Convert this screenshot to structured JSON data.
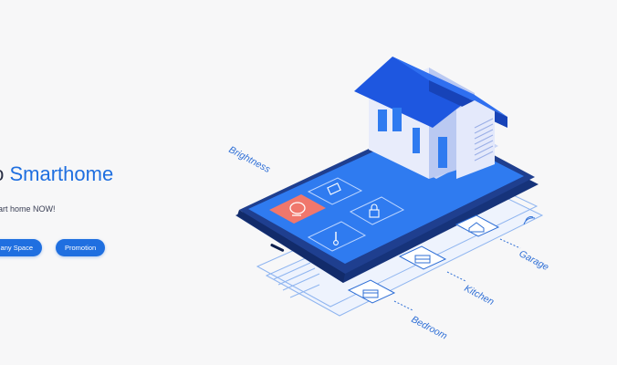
{
  "hero": {
    "heading_prefix": "to ",
    "heading_brand": "Smarthome",
    "subheading": "art home NOW!",
    "buttons": [
      {
        "label": "any Space"
      },
      {
        "label": "Promotion"
      }
    ]
  },
  "illustration": {
    "labels": {
      "brightness": "Brightness",
      "garage": "Garage",
      "kitchen": "Kitchen",
      "bedroom": "Bedroom"
    },
    "icons": [
      "battery-icon",
      "lightbulb-icon",
      "lock-icon",
      "thermometer-icon",
      "house-icon",
      "stove-icon",
      "bed-icon",
      "wifi-icon"
    ],
    "colors": {
      "brand": "#1f6fe0",
      "phone_body": "#1f3f8f",
      "phone_screen": "#2f7bf0",
      "accent_tile": "#f0776c",
      "roof": "#1e57e0"
    }
  }
}
